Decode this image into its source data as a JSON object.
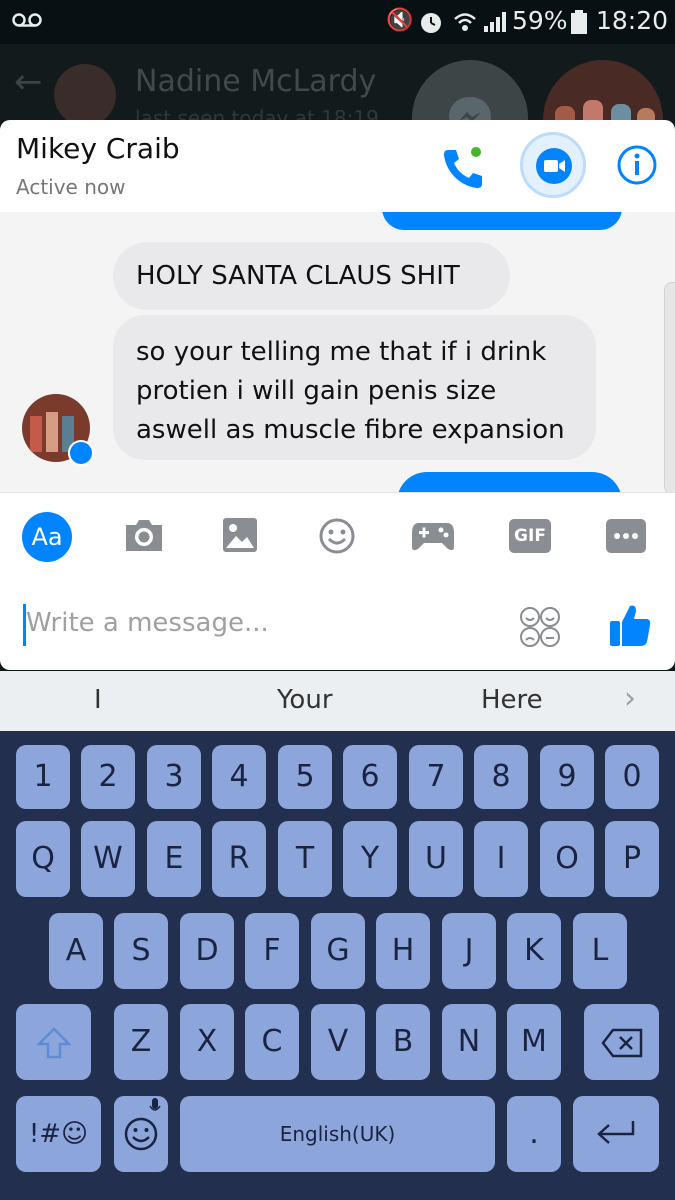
{
  "status_bar": {
    "battery": "59%",
    "time": "18:20"
  },
  "background_chat": {
    "name": "Nadine McLardy",
    "status": "last seen today at 18:19"
  },
  "header": {
    "name": "Mikey Craib",
    "status": "Active now"
  },
  "messages": [
    {
      "text": "HOLY SANTA CLAUS SHIT"
    },
    {
      "line1": "so your telling me that if i drink",
      "line2": "protien i will gain penis size",
      "line3": "aswell as muscle fibre expansion"
    }
  ],
  "toolbar": {
    "text_button": "Aa",
    "gif_button": "GIF"
  },
  "compose": {
    "placeholder": "Write a message..."
  },
  "suggestions": [
    "I",
    "Your",
    "Here"
  ],
  "keyboard": {
    "numbers": [
      "1",
      "2",
      "3",
      "4",
      "5",
      "6",
      "7",
      "8",
      "9",
      "0"
    ],
    "row1": [
      "Q",
      "W",
      "E",
      "R",
      "T",
      "Y",
      "U",
      "I",
      "O",
      "P"
    ],
    "row2": [
      "A",
      "S",
      "D",
      "F",
      "G",
      "H",
      "J",
      "K",
      "L"
    ],
    "row3": [
      "Z",
      "X",
      "C",
      "V",
      "B",
      "N",
      "M"
    ],
    "symbols": "!#☺",
    "space": "English(UK)",
    "period": "."
  },
  "colors": {
    "messenger_blue": "#0084ff",
    "keyboard_bg": "#222f4e",
    "key": "#8ca6dc"
  }
}
